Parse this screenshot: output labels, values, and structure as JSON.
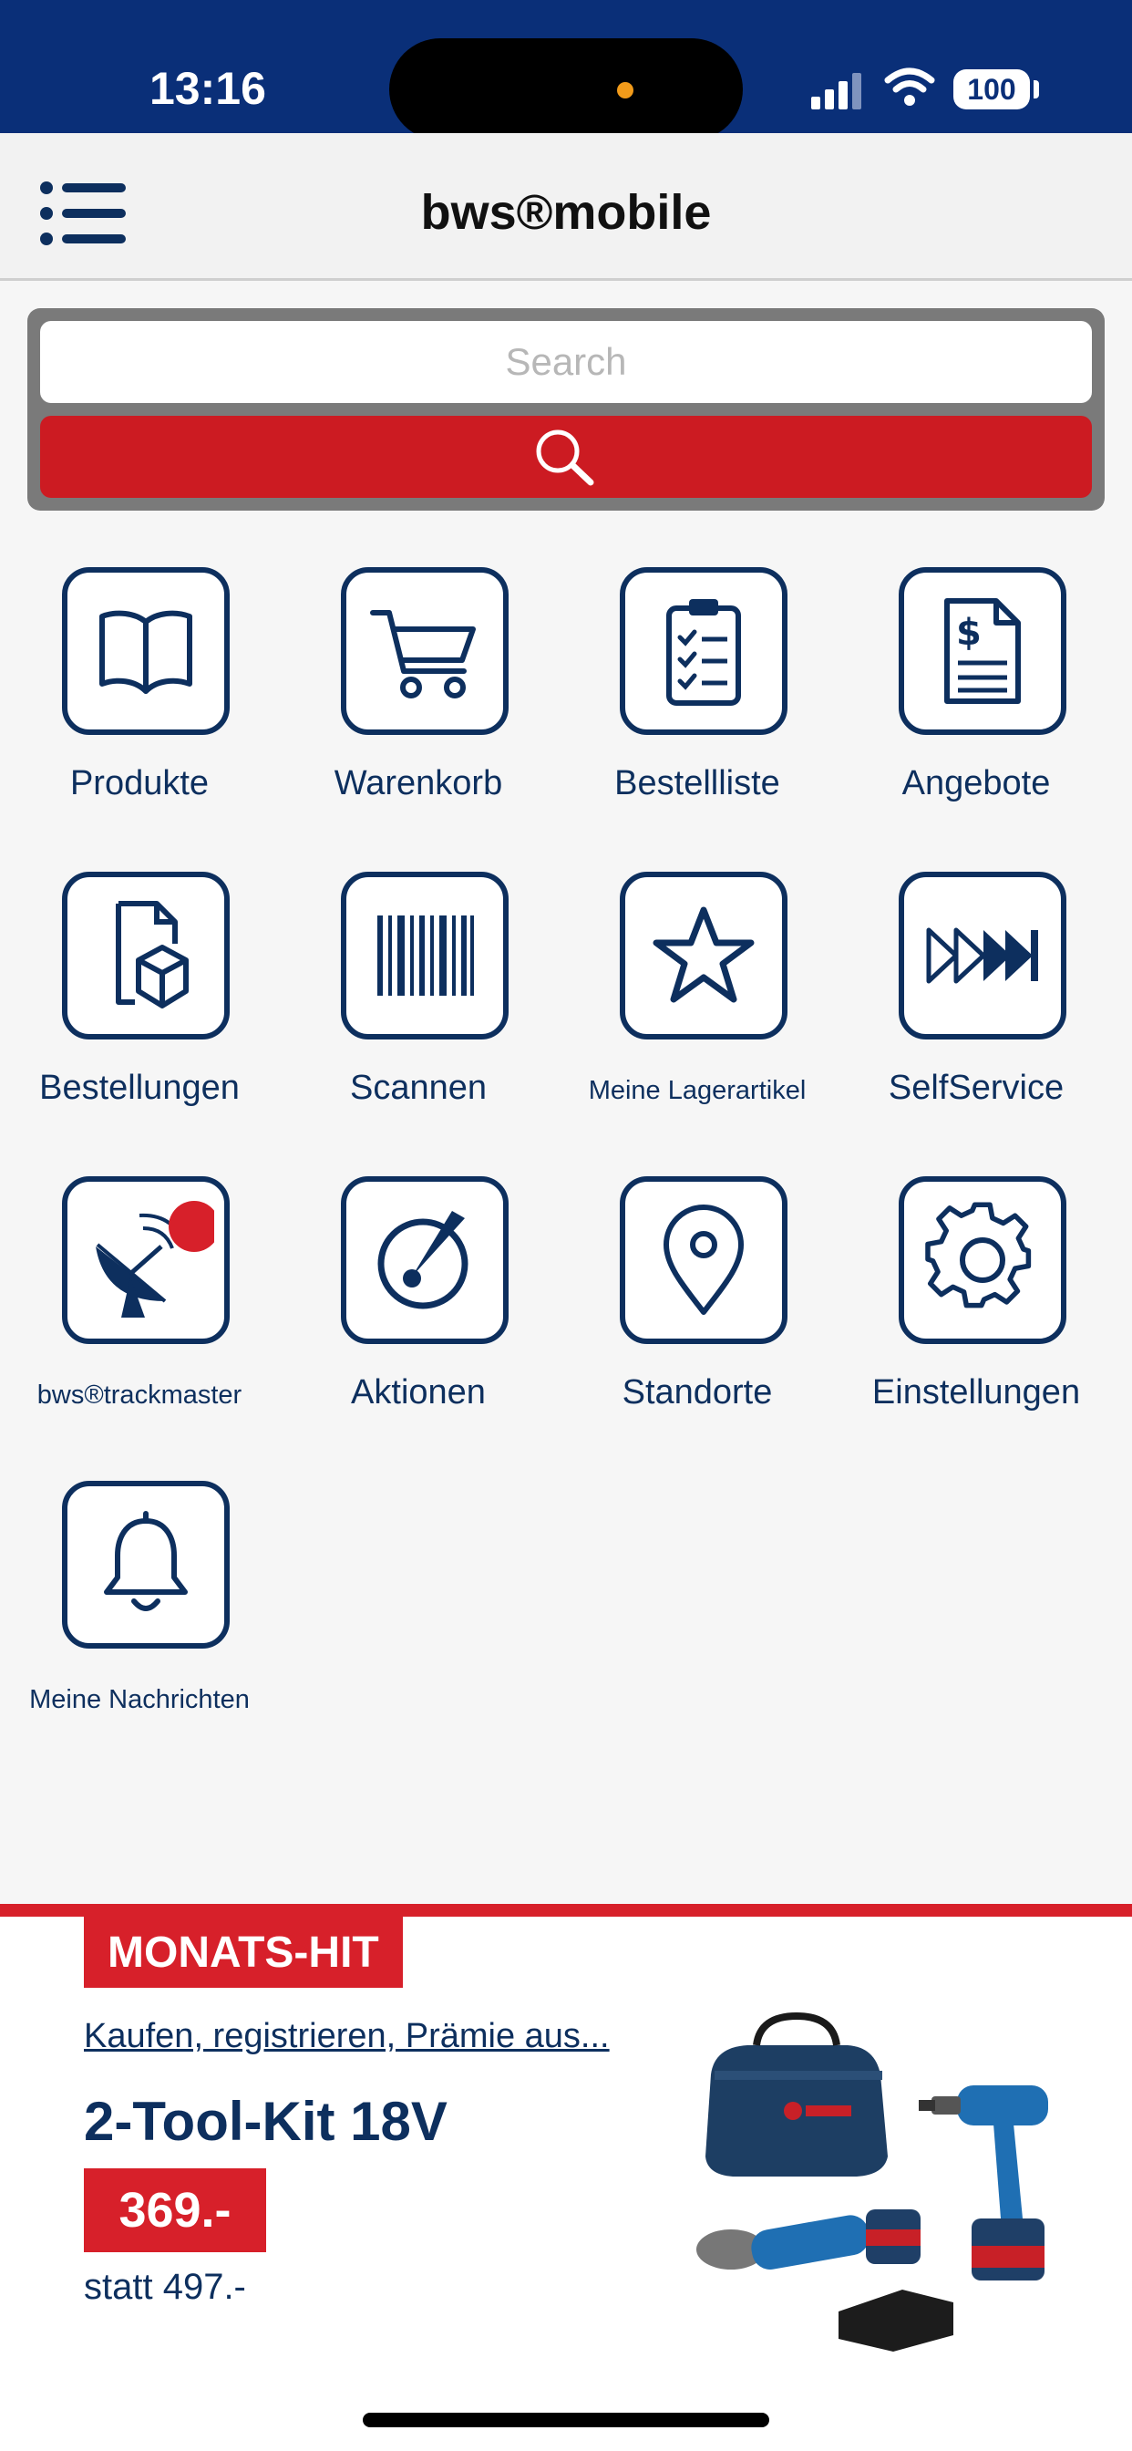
{
  "status_bar": {
    "time": "13:16",
    "battery": "100"
  },
  "header": {
    "title": "bws®mobile"
  },
  "search": {
    "placeholder": "Search"
  },
  "tiles": [
    {
      "label": "Produkte",
      "icon": "book-icon"
    },
    {
      "label": "Warenkorb",
      "icon": "cart-icon"
    },
    {
      "label": "Bestellliste",
      "icon": "clipboard-icon"
    },
    {
      "label": "Angebote",
      "icon": "invoice-icon"
    },
    {
      "label": "Bestellungen",
      "icon": "package-document-icon"
    },
    {
      "label": "Scannen",
      "icon": "barcode-icon"
    },
    {
      "label": "Meine Lagerartikel",
      "icon": "star-icon"
    },
    {
      "label": "SelfService",
      "icon": "fast-forward-icon"
    },
    {
      "label": "bws®trackmaster",
      "icon": "satellite-dish-icon"
    },
    {
      "label": "Aktionen",
      "icon": "compass-icon"
    },
    {
      "label": "Standorte",
      "icon": "location-pin-icon"
    },
    {
      "label": "Einstellungen",
      "icon": "gear-icon"
    },
    {
      "label": "Meine Nachrichten",
      "icon": "bell-icon"
    }
  ],
  "promo": {
    "badge": "MONATS-HIT",
    "link": "Kaufen, registrieren, Prämie aus...",
    "title": "2-Tool-Kit 18V",
    "price": "369.-",
    "old_price": "statt 497.-"
  },
  "colors": {
    "navy": "#0d2f5e",
    "red": "#cc1b22",
    "status_bar": "#0a2f78"
  }
}
